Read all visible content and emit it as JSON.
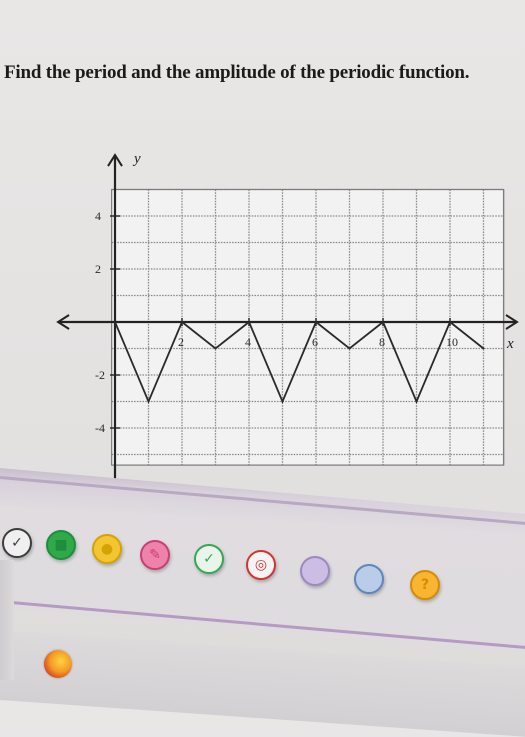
{
  "question": {
    "text": "Find the period and the amplitude of the periodic function."
  },
  "graph": {
    "x_axis_label": "x",
    "y_axis_label": "y",
    "x_ticks": [
      {
        "value": 2,
        "label": "2"
      },
      {
        "value": 4,
        "label": "4"
      },
      {
        "value": 6,
        "label": "6"
      },
      {
        "value": 8,
        "label": "8"
      },
      {
        "value": 10,
        "label": "10"
      }
    ],
    "y_ticks": [
      {
        "value": 4,
        "label": "4"
      },
      {
        "value": 2,
        "label": "2"
      },
      {
        "value": -2,
        "label": "-2"
      },
      {
        "value": -4,
        "label": "-4"
      }
    ],
    "xlim": [
      -1.5,
      11.5
    ],
    "ylim": [
      -6.5,
      6
    ],
    "grid": true,
    "curve_points": [
      [
        0,
        0
      ],
      [
        1,
        -3
      ],
      [
        2,
        0
      ],
      [
        3,
        -1
      ],
      [
        4,
        0
      ],
      [
        5,
        -3
      ],
      [
        6,
        0
      ],
      [
        7,
        -1
      ],
      [
        8,
        0
      ],
      [
        9,
        -3
      ],
      [
        10,
        0
      ],
      [
        11,
        -1
      ]
    ],
    "curve_color": "#2a2a2a",
    "grid_color": "#8c8c8c"
  },
  "toolbar": {
    "tools": [
      {
        "icon": "checkmark-icon",
        "color": "#3d3d3d",
        "fill": "#f0f0f0",
        "glyph": "✓"
      },
      {
        "icon": "green-book-icon",
        "color": "#1e8e3e",
        "fill": "#2faa48",
        "glyph": "■"
      },
      {
        "icon": "yellow-star-icon",
        "color": "#d6a400",
        "fill": "#f3c533",
        "glyph": "●"
      },
      {
        "icon": "pink-pin-icon",
        "color": "#c93f74",
        "fill": "#ef82ab",
        "glyph": "✎"
      },
      {
        "icon": "green-circle-check-icon",
        "color": "#34a853",
        "fill": "#e9f5ea",
        "glyph": "✓"
      },
      {
        "icon": "target-icon",
        "color": "#d3342d",
        "fill": "#f4f4f4",
        "glyph": "◎"
      },
      {
        "icon": "lavender-blob-icon",
        "color": "#9d88c2",
        "fill": "#cbbde4",
        "glyph": ""
      },
      {
        "icon": "blue-pencil-icon",
        "color": "#5f86bd",
        "fill": "#b9cce8",
        "glyph": ""
      },
      {
        "icon": "help-question-icon",
        "color": "#d98b00",
        "fill": "#f7b531",
        "glyph": "?"
      }
    ]
  },
  "taskbar": {
    "firefox_icon": "firefox-icon"
  }
}
